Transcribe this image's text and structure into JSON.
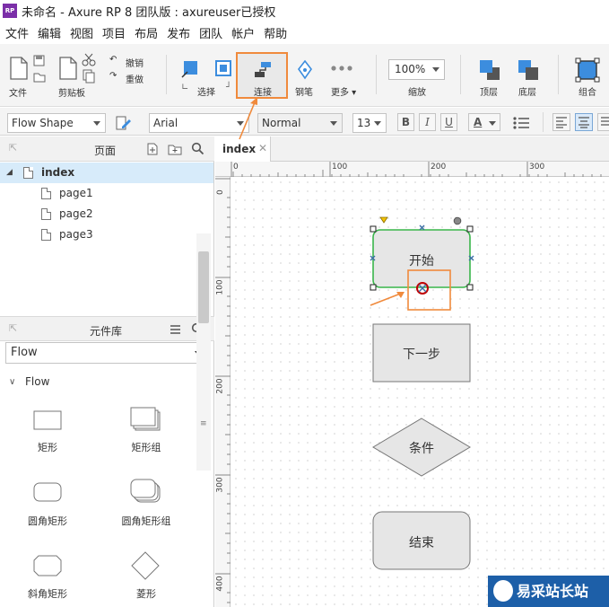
{
  "app": {
    "logo_text": "RP",
    "title": "未命名 - Axure RP 8 团队版 : axureuser已授权"
  },
  "menu": [
    "文件",
    "编辑",
    "视图",
    "项目",
    "布局",
    "发布",
    "团队",
    "帐户",
    "帮助"
  ],
  "toolbar": {
    "file": "文件",
    "clipboard": "剪贴板",
    "undo": "撤销",
    "redo": "重做",
    "select": "选择",
    "connect": "连接",
    "pen": "钢笔",
    "more": "更多 ▾",
    "zoom_value": "100%",
    "zoom": "缩放",
    "top": "顶层",
    "bottom": "底层",
    "group": "组合"
  },
  "formatbar": {
    "shape_style": "Flow Shape",
    "font": "Arial",
    "weight": "Normal",
    "size": "13",
    "bold": "B",
    "italic": "I",
    "underline": "U",
    "font_color": "A"
  },
  "pages_panel": {
    "title": "页面",
    "root": "index",
    "children": [
      "page1",
      "page2",
      "page3"
    ]
  },
  "library_panel": {
    "title": "元件库",
    "selected": "Flow",
    "group": "Flow",
    "items": [
      "矩形",
      "矩形组",
      "圆角矩形",
      "圆角矩形组",
      "斜角矩形",
      "菱形"
    ]
  },
  "canvas": {
    "tab": "index",
    "ruler_h": [
      "0",
      "100",
      "200",
      "300"
    ],
    "ruler_v": [
      "0",
      "100",
      "200",
      "300",
      "400"
    ],
    "shapes": [
      "开始",
      "下一步",
      "条件",
      "结束"
    ]
  },
  "watermark": {
    "text": "易采站长站"
  },
  "colors": {
    "highlight": "#f08a3c",
    "selection": "#39b54a",
    "connector_handle": "#c00000",
    "accent": "#3c8dde"
  }
}
